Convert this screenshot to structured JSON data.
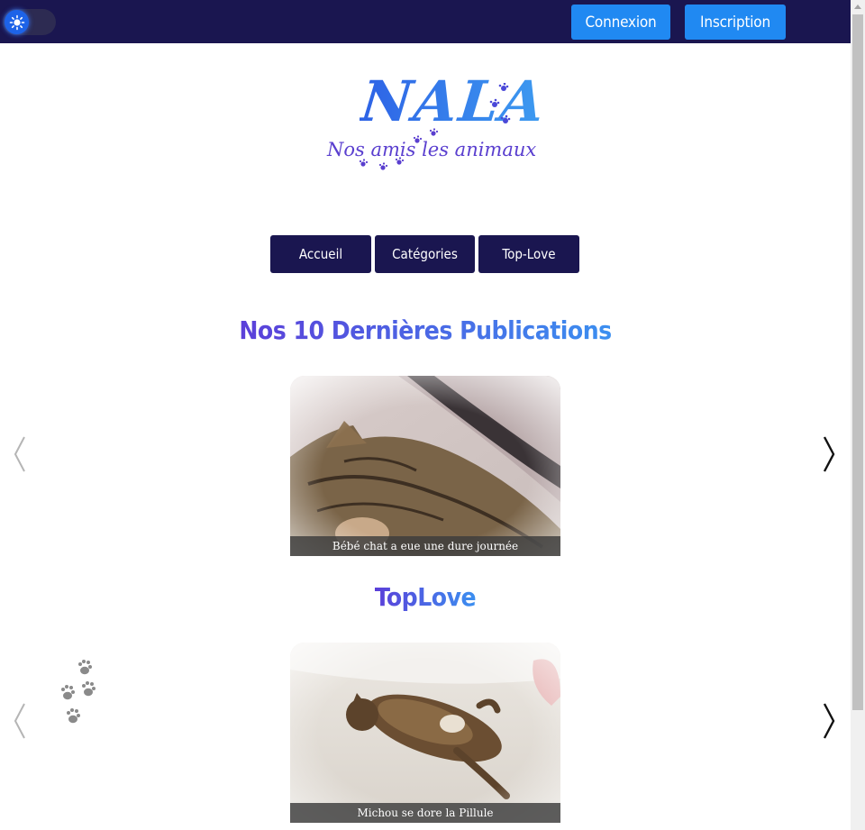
{
  "header": {
    "theme_toggle_icon": "sun-icon",
    "login_label": "Connexion",
    "signup_label": "Inscription",
    "colors": {
      "bar": "#1a1650",
      "button": "#2089f2"
    }
  },
  "logo": {
    "title": "NALA",
    "tagline": "Nos amis les animaux"
  },
  "nav": {
    "items": [
      {
        "label": "Accueil"
      },
      {
        "label": "Catégories"
      },
      {
        "label": "Top-Love"
      }
    ]
  },
  "sections": {
    "latest": {
      "title": "Nos 10 Dernières Publications",
      "caption": "Bébé chat a eue une dure journée",
      "prev_icon": "chevron-left-icon",
      "next_icon": "chevron-right-icon"
    },
    "top": {
      "title": "TopLove",
      "caption": "Michou se dore la Pillule",
      "prev_icon": "chevron-left-icon",
      "next_icon": "chevron-right-icon"
    }
  },
  "decoration": {
    "paws_icon": "paw-prints-icon"
  }
}
